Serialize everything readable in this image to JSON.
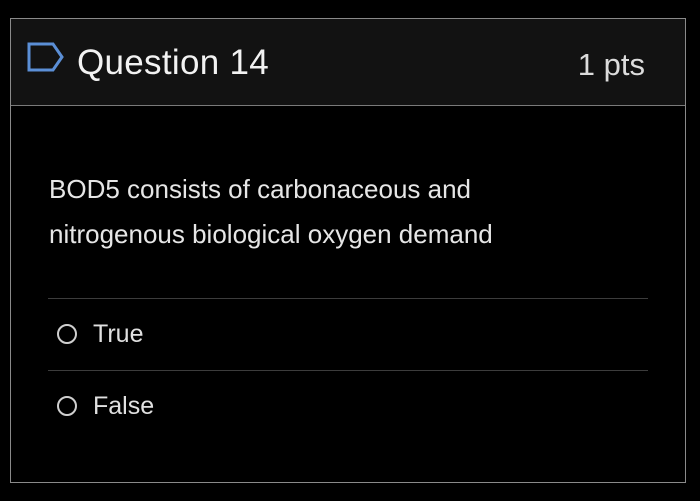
{
  "question": {
    "title": "Question 14",
    "points": "1 pts",
    "flag_icon": "bookmark-flag-icon",
    "text": "BOD5 consists of carbonaceous and nitrogenous biological oxygen demand"
  },
  "answers": [
    {
      "label": "True",
      "selected": false
    },
    {
      "label": "False",
      "selected": false
    }
  ],
  "colors": {
    "background": "#000000",
    "header_background": "#121212",
    "border": "#8a8a8a",
    "flag_icon": "#5b8fd6",
    "text": "#e6e6e6"
  }
}
